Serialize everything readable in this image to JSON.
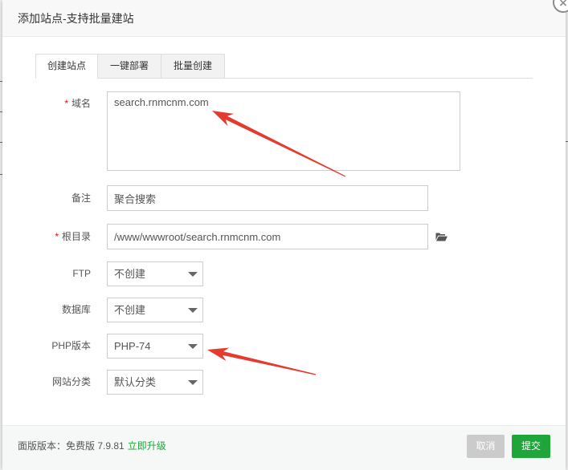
{
  "dialog": {
    "title": "添加站点-支持批量建站",
    "close_icon": "close-icon"
  },
  "tabs": [
    {
      "label": "创建站点",
      "active": true
    },
    {
      "label": "一键部署",
      "active": false
    },
    {
      "label": "批量创建",
      "active": false
    }
  ],
  "form": {
    "domain": {
      "required_mark": "*",
      "label": "域名",
      "value": "search.rnmcnm.com"
    },
    "remark": {
      "label": "备注",
      "value": "聚合搜索"
    },
    "root_dir": {
      "required_mark": "*",
      "label": "根目录",
      "value": "/www/wwwroot/search.rnmcnm.com",
      "browse_icon": "folder-open-icon"
    },
    "ftp": {
      "label": "FTP",
      "selected": "不创建",
      "arrow_icon": "chevron-down-icon"
    },
    "database": {
      "label": "数据库",
      "selected": "不创建",
      "arrow_icon": "chevron-down-icon"
    },
    "php_version": {
      "label": "PHP版本",
      "selected": "PHP-74",
      "arrow_icon": "chevron-down-icon"
    },
    "site_category": {
      "label": "网站分类",
      "selected": "默认分类",
      "arrow_icon": "chevron-down-icon"
    }
  },
  "footer": {
    "version_text": "面版版本：免费版 7.9.81",
    "upgrade_link": "立即升级",
    "cancel_label": "取消",
    "submit_label": "提交"
  },
  "colors": {
    "accent": "#20a53a",
    "required": "#ff0000",
    "cancel_button": "#cbcbcb",
    "annotation_arrow": "#e63a2e"
  }
}
